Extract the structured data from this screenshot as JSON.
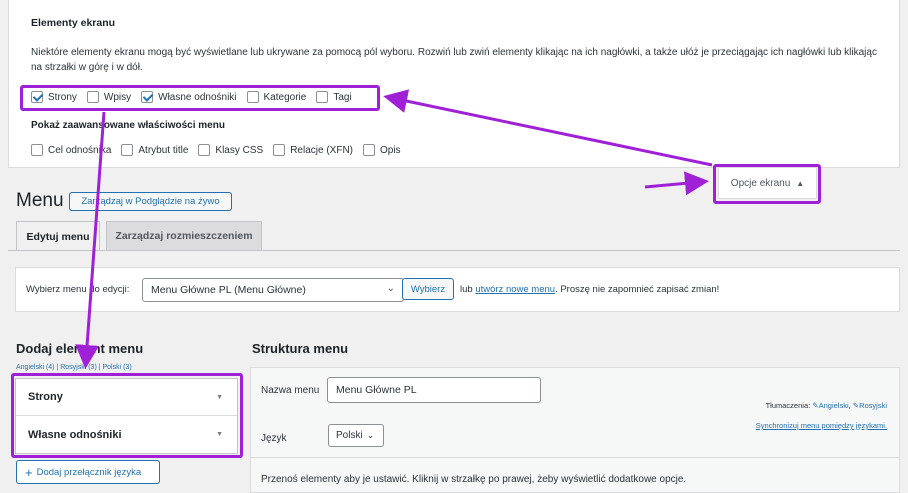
{
  "screen_options": {
    "title": "Elementy ekranu",
    "description": "Niektóre elementy ekranu mogą być wyświetlane lub ukrywane za pomocą pól wyboru. Rozwiń lub zwiń elementy klikając na ich nagłówki, a także ułóż je przeciągając ich nagłówki lub klikając na strzałki w górę i w dół.",
    "boxes": [
      {
        "label": "Strony",
        "checked": true
      },
      {
        "label": "Wpisy",
        "checked": false
      },
      {
        "label": "Własne odnośniki",
        "checked": true
      },
      {
        "label": "Kategorie",
        "checked": false
      },
      {
        "label": "Tagi",
        "checked": false
      }
    ],
    "advanced_title": "Pokaż zaawansowane właściwości menu",
    "advanced": [
      {
        "label": "Cel odnośnika",
        "checked": false
      },
      {
        "label": "Atrybut title",
        "checked": false
      },
      {
        "label": "Klasy CSS",
        "checked": false
      },
      {
        "label": "Relacje (XFN)",
        "checked": false
      },
      {
        "label": "Opis",
        "checked": false
      }
    ],
    "toggle_label": "Opcje ekranu",
    "toggle_icon": "▲"
  },
  "header": {
    "title": "Menu",
    "live_preview": "Zarządzaj w Podglądzie na żywo"
  },
  "tabs": [
    {
      "label": "Edytuj menu"
    },
    {
      "label": "Zarządzaj rozmieszczeniem"
    }
  ],
  "select_bar": {
    "label": "Wybierz menu do edycji:",
    "selected": "Menu Główne PL (Menu Główne)",
    "button": "Wybierz",
    "or": "lub",
    "create_link": "utwórz nowe menu",
    "hint": ". Proszę nie zapomnieć zapisać zmian!"
  },
  "add_items": {
    "title": "Dodaj element menu",
    "lang_links": "Angielski (4) | Rosyjski (3) | Polski (3)",
    "sections": [
      {
        "label": "Strony"
      },
      {
        "label": "Własne odnośniki"
      }
    ],
    "add_lang_button": "Dodaj przełącznik języka"
  },
  "structure": {
    "title": "Struktura menu",
    "name_label": "Nazwa menu",
    "name_value": "Menu Główne PL",
    "translations_label": "Tłumaczenia:",
    "translations": [
      "Angielski",
      "Rosyjski"
    ],
    "sync_link": "Synchronizuj menu pomiędzy językami.",
    "lang_label": "Język",
    "lang_value": "Polski",
    "note": "Przenoś elementy aby je ustawić. Kliknij w strzałkę po prawej, żeby wyświetlić dodatkowe opcje."
  },
  "colors": {
    "accent": "#2271b1",
    "annotation": "#a020d8"
  }
}
